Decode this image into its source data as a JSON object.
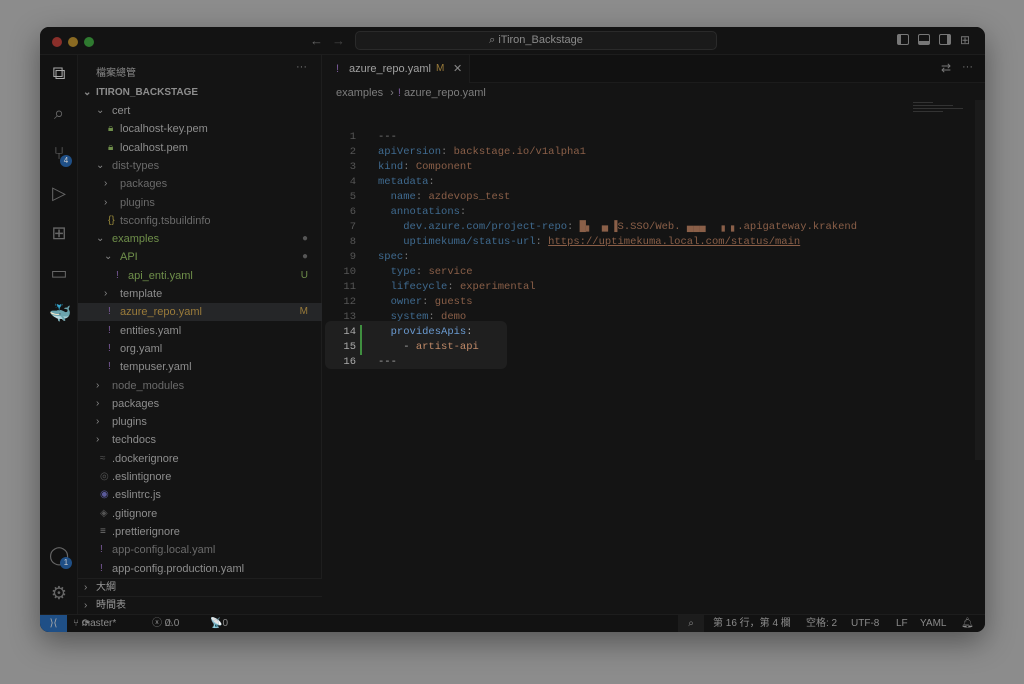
{
  "window": {
    "title": "iTiron_Backstage"
  },
  "colors": {
    "accent": "#1f4f86",
    "modified": "#9a7b3a",
    "untracked": "#6f8f4a",
    "added_gutter": "#3f8f3f"
  },
  "activity_bar": {
    "items": [
      {
        "icon": "files-icon"
      },
      {
        "icon": "search-icon"
      },
      {
        "icon": "source-control-icon",
        "badge": "4"
      },
      {
        "icon": "run-debug-icon"
      },
      {
        "icon": "extensions-icon"
      },
      {
        "icon": "remote-explorer-icon"
      },
      {
        "icon": "docker-icon"
      }
    ],
    "bottom": [
      {
        "icon": "account-icon",
        "badge": "1"
      },
      {
        "icon": "gear-icon"
      }
    ]
  },
  "sidebar": {
    "title": "檔案總管",
    "more": "···",
    "root": "ITIRON_BACKSTAGE",
    "items": [
      {
        "label": "cert",
        "type": "folder-open",
        "depth": 1
      },
      {
        "label": "localhost-key.pem",
        "type": "lock",
        "depth": 2
      },
      {
        "label": "localhost.pem",
        "type": "lock",
        "depth": 2
      },
      {
        "label": "dist-types",
        "type": "folder-open",
        "depth": 1,
        "dim": true
      },
      {
        "label": "packages",
        "type": "folder",
        "depth": 2,
        "dim": true
      },
      {
        "label": "plugins",
        "type": "folder",
        "depth": 2,
        "dim": true
      },
      {
        "label": "tsconfig.tsbuildinfo",
        "type": "json",
        "depth": 2,
        "dim": true
      },
      {
        "label": "examples",
        "type": "folder-open",
        "depth": 1,
        "status": "●",
        "color": "untracked"
      },
      {
        "label": "API",
        "type": "folder-open",
        "depth": 2,
        "status": "●",
        "color": "untracked"
      },
      {
        "label": "api_enti.yaml",
        "type": "yaml",
        "depth": 3,
        "status": "U",
        "color": "untracked"
      },
      {
        "label": "template",
        "type": "folder",
        "depth": 2
      },
      {
        "label": "azure_repo.yaml",
        "type": "yaml",
        "depth": 2,
        "status": "M",
        "color": "modified",
        "selected": true
      },
      {
        "label": "entities.yaml",
        "type": "yaml",
        "depth": 2
      },
      {
        "label": "org.yaml",
        "type": "yaml",
        "depth": 2
      },
      {
        "label": "tempuser.yaml",
        "type": "yaml",
        "depth": 2
      },
      {
        "label": "node_modules",
        "type": "folder",
        "depth": 1,
        "dim": true
      },
      {
        "label": "packages",
        "type": "folder",
        "depth": 1
      },
      {
        "label": "plugins",
        "type": "folder",
        "depth": 1
      },
      {
        "label": "techdocs",
        "type": "folder",
        "depth": 1
      },
      {
        "label": ".dockerignore",
        "type": "docker",
        "depth": 1
      },
      {
        "label": ".eslintignore",
        "type": "eslint",
        "depth": 1
      },
      {
        "label": ".eslintrc.js",
        "type": "eslint-js",
        "depth": 1
      },
      {
        "label": ".gitignore",
        "type": "git",
        "depth": 1
      },
      {
        "label": ".prettierignore",
        "type": "list",
        "depth": 1
      },
      {
        "label": "app-config.local.yaml",
        "type": "yaml",
        "depth": 1,
        "dim": true
      },
      {
        "label": "app-config.production.yaml",
        "type": "yaml",
        "depth": 1
      }
    ],
    "sections": [
      "大綱",
      "時間表"
    ]
  },
  "editor": {
    "tab": {
      "label": "azure_repo.yaml",
      "status": "M"
    },
    "breadcrumb": [
      "examples",
      "azure_repo.yaml"
    ],
    "lines": [
      [
        [
          "p",
          "---"
        ]
      ],
      [
        [
          "k",
          "apiVersion"
        ],
        [
          "p",
          ": "
        ],
        [
          "v",
          "backstage.io/v1alpha1"
        ]
      ],
      [
        [
          "k",
          "kind"
        ],
        [
          "p",
          ": "
        ],
        [
          "v",
          "Component"
        ]
      ],
      [
        [
          "k",
          "metadata"
        ],
        [
          "p",
          ":"
        ]
      ],
      [
        [
          "p",
          "  "
        ],
        [
          "k",
          "name"
        ],
        [
          "p",
          ": "
        ],
        [
          "v",
          "azdevops_test"
        ]
      ],
      [
        [
          "p",
          "  "
        ],
        [
          "k",
          "annotations"
        ],
        [
          "p",
          ":"
        ]
      ],
      [
        [
          "p",
          "    "
        ],
        [
          "k",
          "dev.azure.com/project-repo"
        ],
        [
          "p",
          ": "
        ],
        [
          "v",
          "█▖ ▗▖▐S.SSO/Web. ▄▄▄  ▗ ▖.apigateway.krakend"
        ]
      ],
      [
        [
          "p",
          "    "
        ],
        [
          "k",
          "uptimekuma/status-url"
        ],
        [
          "p",
          ": "
        ],
        [
          "u",
          "https://uptimekuma.local.com/status/main"
        ]
      ],
      [
        [
          "k",
          "spec"
        ],
        [
          "p",
          ":"
        ]
      ],
      [
        [
          "p",
          "  "
        ],
        [
          "k",
          "type"
        ],
        [
          "p",
          ": "
        ],
        [
          "v",
          "service"
        ]
      ],
      [
        [
          "p",
          "  "
        ],
        [
          "k",
          "lifecycle"
        ],
        [
          "p",
          ": "
        ],
        [
          "v",
          "experimental"
        ]
      ],
      [
        [
          "p",
          "  "
        ],
        [
          "k",
          "owner"
        ],
        [
          "p",
          ": "
        ],
        [
          "v",
          "guests"
        ]
      ],
      [
        [
          "p",
          "  "
        ],
        [
          "k",
          "system"
        ],
        [
          "p",
          ": "
        ],
        [
          "v",
          "demo"
        ]
      ],
      [
        [
          "p",
          "  "
        ],
        [
          "k",
          "providesApis"
        ],
        [
          "p",
          ":"
        ]
      ],
      [
        [
          "p",
          "    - "
        ],
        [
          "v",
          "artist-api"
        ]
      ],
      [
        [
          "p",
          "---"
        ]
      ]
    ]
  },
  "status_bar": {
    "branch": "master*",
    "errors": "0",
    "warnings": "0",
    "ports": "0",
    "cursor": "第 16 行，第 4 欄",
    "indent": "空格: 2",
    "encoding": "UTF-8",
    "eol": "LF",
    "language": "YAML"
  }
}
